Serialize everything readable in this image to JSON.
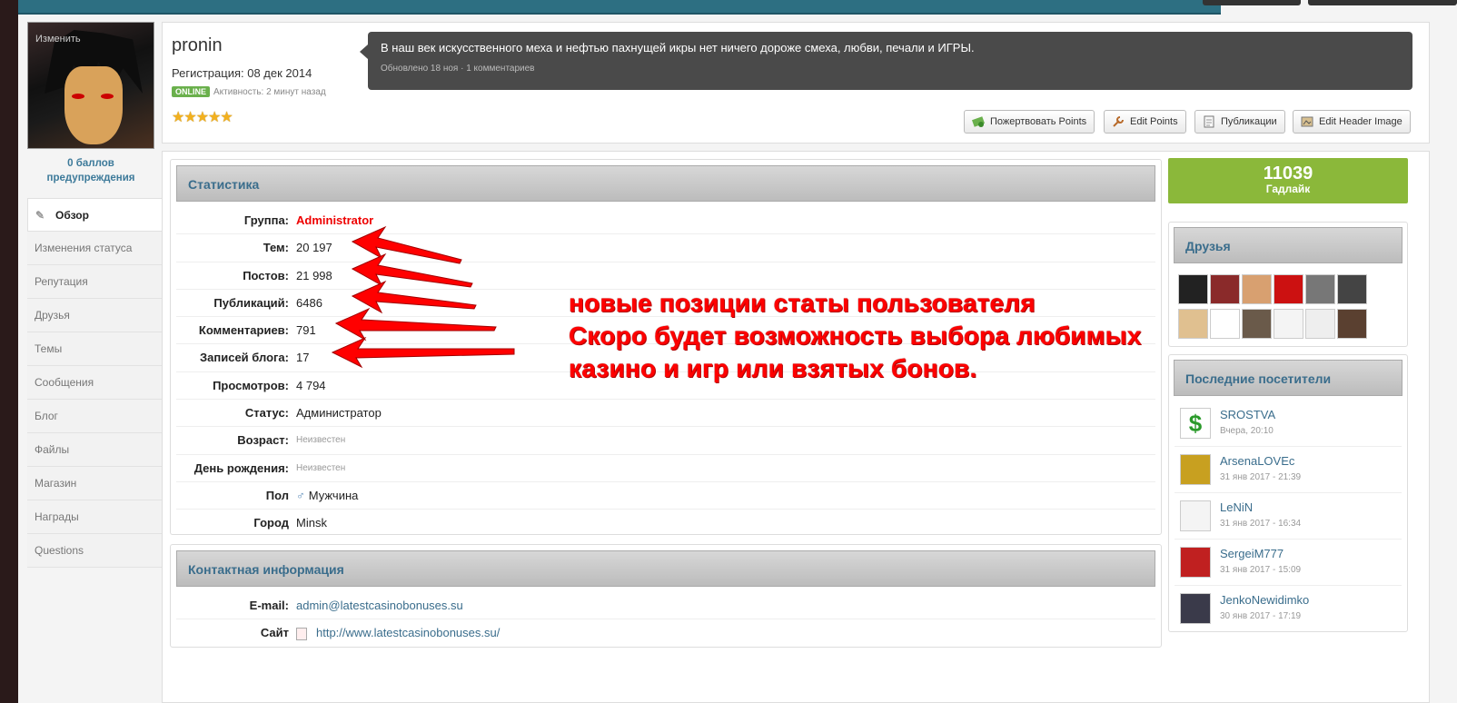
{
  "profile": {
    "edit_label": "Изменить",
    "username": "pronin",
    "registration": "Регистрация: 08 дек 2014",
    "online_badge": "ONLINE",
    "activity": "Активность: 2 минут назад",
    "stars": "★★★★★",
    "warnings": "0 баллов предупреждения"
  },
  "status": {
    "text": "В наш век искусственного меха и нефтью пахнущей икры нет ничего дороже смеха, любви, печали и ИГРЫ.",
    "meta": "Обновлено 18 ноя · 1 комментариев"
  },
  "buttons": {
    "donate": "Пожертвовать Points",
    "edit_points": "Edit Points",
    "publications": "Публикации",
    "edit_header": "Edit Header Image"
  },
  "nav": [
    {
      "label": "Обзор"
    },
    {
      "label": "Изменения статуса"
    },
    {
      "label": "Репутация"
    },
    {
      "label": "Друзья"
    },
    {
      "label": "Темы"
    },
    {
      "label": "Сообщения"
    },
    {
      "label": "Блог"
    },
    {
      "label": "Файлы"
    },
    {
      "label": "Магазин"
    },
    {
      "label": "Награды"
    },
    {
      "label": "Questions"
    }
  ],
  "stats": {
    "title": "Статистика",
    "rows": [
      {
        "label": "Группа:",
        "value": "Administrator"
      },
      {
        "label": "Тем:",
        "value": "20 197"
      },
      {
        "label": "Постов:",
        "value": "21 998"
      },
      {
        "label": "Публикаций:",
        "value": "6486"
      },
      {
        "label": "Комментариев:",
        "value": "791"
      },
      {
        "label": "Записей блога:",
        "value": "17"
      },
      {
        "label": "Просмотров:",
        "value": "4 794"
      },
      {
        "label": "Статус:",
        "value": "Администратор"
      },
      {
        "label": "Возраст:",
        "value": "Неизвестен"
      },
      {
        "label": "День рождения:",
        "value": "Неизвестен"
      },
      {
        "label": "Пол",
        "value": "Мужчина"
      },
      {
        "label": "Город",
        "value": "Minsk"
      }
    ]
  },
  "contact": {
    "title": "Контактная информация",
    "rows": [
      {
        "label": "E-mail:",
        "value": "admin@latestcasinobonuses.su"
      },
      {
        "label": "Сайт",
        "value": "http://www.latestcasinobonuses.su/"
      }
    ]
  },
  "gadlike": {
    "count": "11039",
    "label": "Гадлайк"
  },
  "friends": {
    "title": "Друзья"
  },
  "visitors": {
    "title": "Последние посетители",
    "items": [
      {
        "name": "SROSTVA",
        "date": "Вчера, 20:10"
      },
      {
        "name": "ArsenaLOVEc",
        "date": "31 янв 2017 - 21:39"
      },
      {
        "name": "LeNiN",
        "date": "31 янв 2017 - 16:34"
      },
      {
        "name": "SergeiM777",
        "date": "31 янв 2017 - 15:09"
      },
      {
        "name": "JenkoNewidimko",
        "date": "30 янв 2017 - 17:19"
      }
    ]
  },
  "annotation": {
    "line1": "новые позиции статы пользователя",
    "line2": "Скоро будет возможность выбора любимых",
    "line3": "казино и игр или взятых бонов."
  },
  "colors": {
    "accent": "#3a6d8c",
    "gadlike": "#8bb83a",
    "annotation": "#ff0000"
  }
}
